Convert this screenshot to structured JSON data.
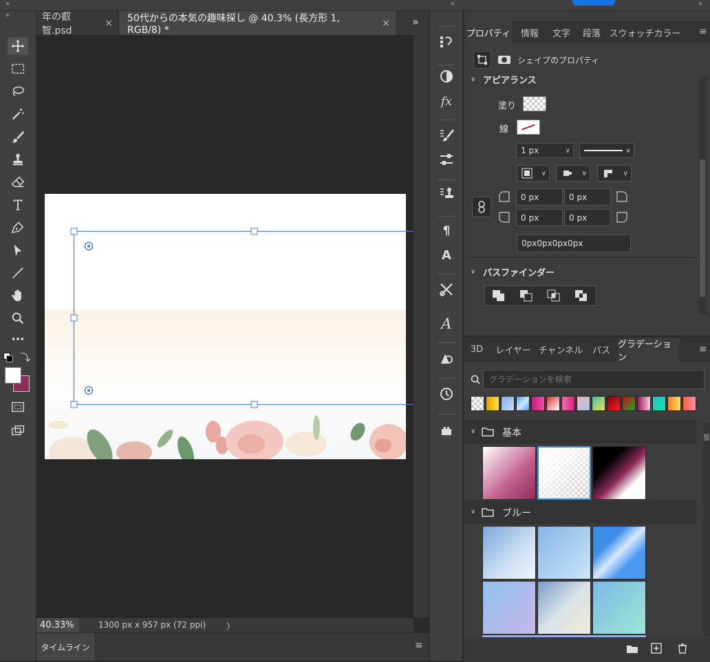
{
  "document_tabs": [
    {
      "label": "年の叡智.psd",
      "close": "×"
    },
    {
      "label": "50代からの本気の趣味探し @ 40.3% (長方形 1, RGB/8) *",
      "close": "×"
    }
  ],
  "tab_overflow": "»",
  "status": {
    "zoom": "40.33%",
    "doc_size": "1300 px x 957 px (72 ppi)",
    "arrow": "〉"
  },
  "timeline": {
    "tab_label": "タイムライン"
  },
  "properties": {
    "tabs": [
      "プロパティ",
      "情報",
      "文字",
      "段落",
      "スウォッチ",
      "カラー"
    ],
    "shape_header": "シェイプのプロパティ",
    "appearance": {
      "title": "アピアランス",
      "fill_label": "塗り",
      "stroke_label": "線",
      "stroke_width": "1 px",
      "corner_tl": "0 px",
      "corner_tr": "0 px",
      "corner_bl": "0 px",
      "corner_br": "0 px",
      "corner_summary": "0px0px0px0px"
    },
    "pathfinder": {
      "title": "パスファインダー"
    }
  },
  "gradients_panel": {
    "tabs": [
      "3D",
      "レイヤー",
      "チャンネル",
      "パス",
      "グラデーション"
    ],
    "search_placeholder": "グラデーションを検索",
    "groups": [
      {
        "name": "基本"
      },
      {
        "name": "ブルー"
      }
    ]
  },
  "colors": {
    "accent_blue": "#4a7fd0",
    "foreground": "#ffffff",
    "background": "#8e2c5c",
    "active_tab": "#535353"
  }
}
